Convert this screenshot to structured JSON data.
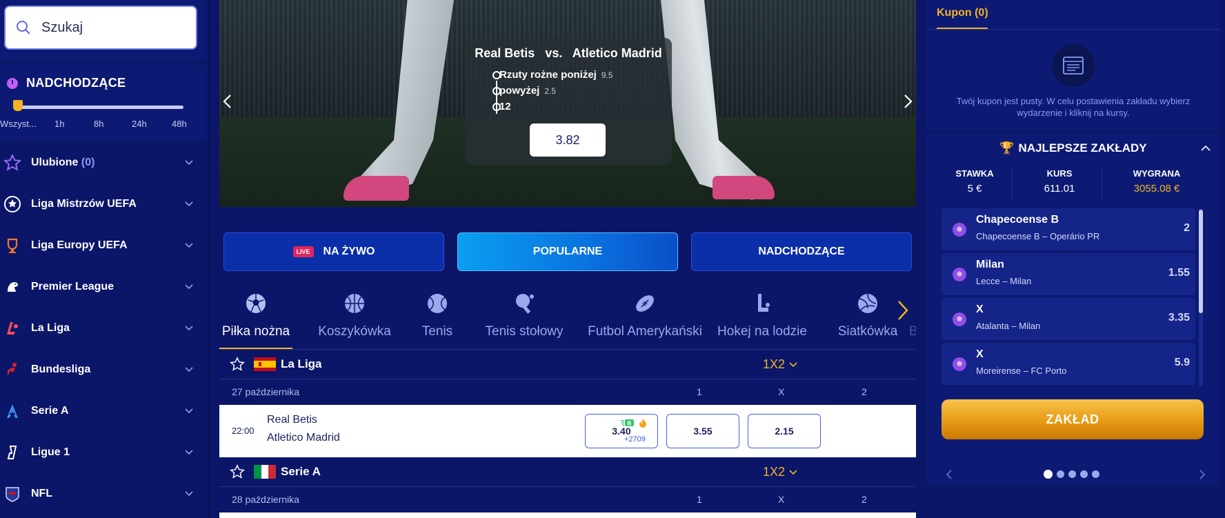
{
  "search": {
    "placeholder": "Szukaj"
  },
  "upcoming": {
    "title": "NADCHODZĄCE",
    "slider_labels": [
      "Wszyst...",
      "1h",
      "8h",
      "24h",
      "48h"
    ],
    "selected": "Wszyst..."
  },
  "menu": {
    "favorites_label": "Ulubione",
    "favorites_count": "(0)",
    "items": [
      {
        "label": "Liga Mistrzów UEFA",
        "icon": "champions-league-icon"
      },
      {
        "label": "Liga Europy UEFA",
        "icon": "europa-league-icon"
      },
      {
        "label": "Premier League",
        "icon": "premier-league-icon"
      },
      {
        "label": "La Liga",
        "icon": "la-liga-icon"
      },
      {
        "label": "Bundesliga",
        "icon": "bundesliga-icon"
      },
      {
        "label": "Serie A",
        "icon": "serie-a-icon"
      },
      {
        "label": "Ligue 1",
        "icon": "ligue-1-icon"
      },
      {
        "label": "NFL",
        "icon": "nfl-icon"
      }
    ]
  },
  "hero": {
    "home": "Real Betis",
    "vs": "vs.",
    "away": "Atletico Madrid",
    "picks": [
      {
        "label": "Rzuty rożne poniżej",
        "value": "9.5"
      },
      {
        "label": "powyżej",
        "value": "2.5"
      },
      {
        "label": "12",
        "value": ""
      }
    ],
    "odd": "3.82"
  },
  "tabs": {
    "live_badge": "LIVE",
    "live_label": "NA ŻYWO",
    "popular_label": "POPULARNE",
    "upcoming_label": "NADCHODZĄCE",
    "active": "POPULARNE"
  },
  "sports": {
    "items": [
      "Piłka nożna",
      "Koszykówka",
      "Tenis",
      "Tenis stołowy",
      "Futbol Amerykański",
      "Hokej na lodzie",
      "Siatkówka",
      "Baseball"
    ],
    "active": "Piłka nożna"
  },
  "leagues": [
    {
      "name": "La Liga",
      "market": "1X2",
      "date": "27 października",
      "cols": [
        "1",
        "X",
        "2"
      ],
      "match": {
        "time": "22:00",
        "home": "Real Betis",
        "away": "Atletico Madrid",
        "more": "+2709",
        "odds": [
          "3.40",
          "3.55",
          "2.15"
        ]
      }
    },
    {
      "name": "Serie A",
      "market": "1X2",
      "date": "28 października",
      "cols": [
        "1",
        "X",
        "2"
      ]
    }
  ],
  "coupon": {
    "tab_label": "Kupon (0)",
    "empty_text": "Twój kupon jest pusty. W celu postawienia zakładu wybierz wydarzenie i kliknij na kursy."
  },
  "best_bets": {
    "title": "NAJLEPSZE ZAKŁADY",
    "stake_label": "STAWKA",
    "stake": "5 €",
    "odds_label": "KURS",
    "odds": "611.01",
    "win_label": "WYGRANA",
    "win": "3055.08 €",
    "items": [
      {
        "pick": "Chapecoense B",
        "event": "Chapecoense B – Operário PR",
        "odd": "2"
      },
      {
        "pick": "Milan",
        "event": "Lecce – Milan",
        "odd": "1.55"
      },
      {
        "pick": "X",
        "event": "Atalanta – Milan",
        "odd": "3.35"
      },
      {
        "pick": "X",
        "event": "Moreirense – FC Porto",
        "odd": "5.9"
      }
    ],
    "place_bet_label": "ZAKŁAD",
    "carousel_pages": 5,
    "carousel_active": 1
  },
  "colors": {
    "bg": "#0b1668",
    "accent": "#f2b324",
    "popular_tab": "#0a9ef0",
    "live_badge": "#e0245e"
  }
}
